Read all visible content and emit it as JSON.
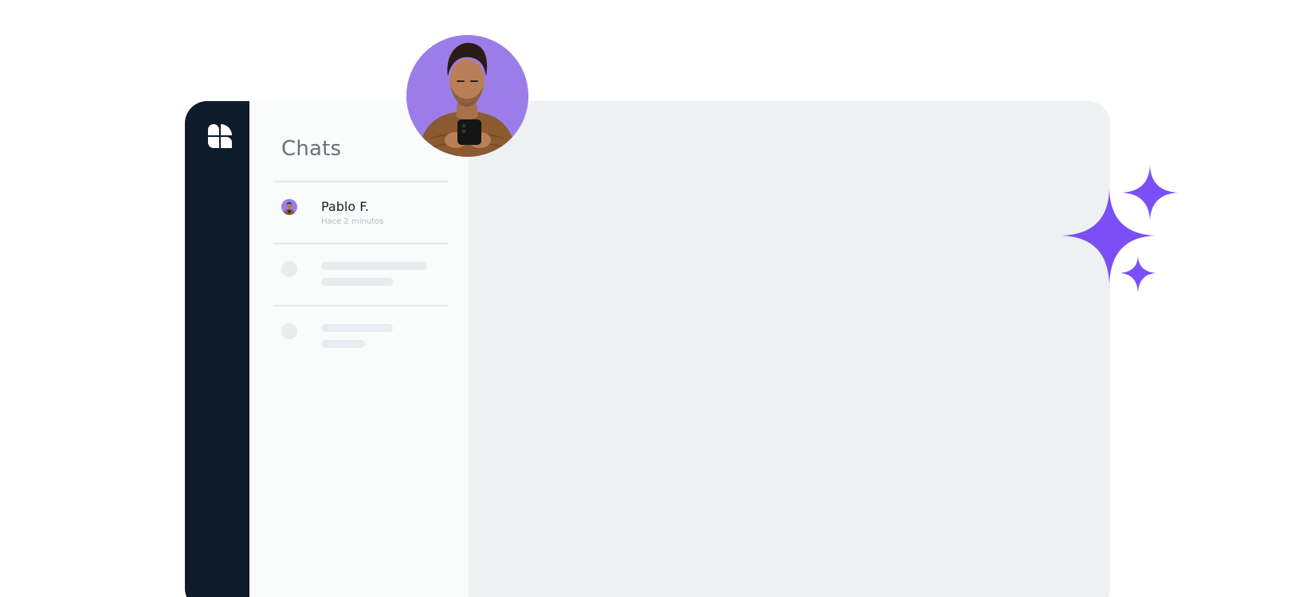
{
  "chat_list": {
    "title": "Chats",
    "items": [
      {
        "name": "Pablo F.",
        "time": "Hace 2 minutos"
      }
    ]
  },
  "colors": {
    "sidebar": "#0d1b2a",
    "accent": "#7b4ff5",
    "avatar_bg": "#9b7dea",
    "conversation_bg": "#edf1f2",
    "list_bg": "#fafbfb"
  },
  "icons": {
    "logo": "app-logo-icon",
    "decoration": "sparkles-icon"
  }
}
